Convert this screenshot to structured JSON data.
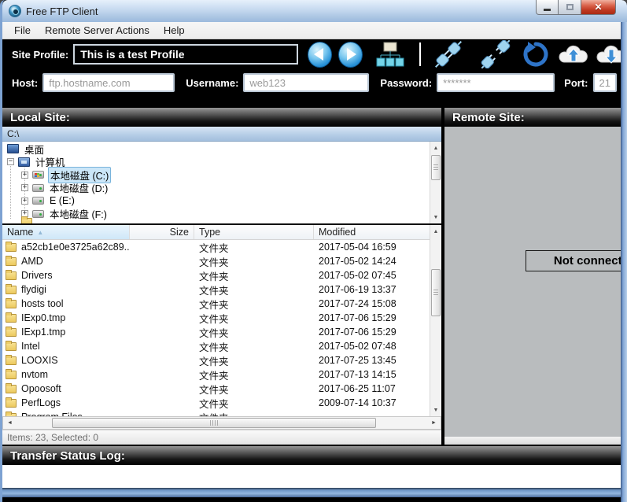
{
  "window": {
    "title": "Free FTP Client"
  },
  "menu": {
    "items": [
      {
        "label": "File"
      },
      {
        "label": "Remote Server Actions"
      },
      {
        "label": "Help"
      }
    ]
  },
  "profile_bar": {
    "label": "Site Profile:",
    "value": "This is a test Profile"
  },
  "connection_bar": {
    "host_label": "Host:",
    "host_value": "ftp.hostname.com",
    "username_label": "Username:",
    "username_value": "web123",
    "password_label": "Password:",
    "password_value": "*******",
    "port_label": "Port:",
    "port_value": "21"
  },
  "local_panel": {
    "header": "Local Site:",
    "path": "C:\\",
    "tree": [
      {
        "label": "桌面",
        "icon": "desktop",
        "expander": null,
        "level": 0,
        "selected": false
      },
      {
        "label": "计算机",
        "icon": "computer",
        "expander": "minus",
        "level": 1,
        "selected": false
      },
      {
        "label": "本地磁盘 (C:)",
        "icon": "drive-win",
        "expander": "plus",
        "level": 2,
        "selected": true
      },
      {
        "label": "本地磁盘 (D:)",
        "icon": "drive",
        "expander": "plus",
        "level": 2,
        "selected": false
      },
      {
        "label": "E (E:)",
        "icon": "drive",
        "expander": "plus",
        "level": 2,
        "selected": false
      },
      {
        "label": "本地磁盘 (F:)",
        "icon": "drive",
        "expander": "plus",
        "level": 2,
        "selected": false
      }
    ],
    "list": {
      "columns": [
        "Name",
        "Size",
        "Type",
        "Modified"
      ],
      "rows": [
        {
          "name": "a52cb1e0e3725a62c89...",
          "size": "",
          "type": "文件夹",
          "modified": "2017-05-04 16:59"
        },
        {
          "name": "AMD",
          "size": "",
          "type": "文件夹",
          "modified": "2017-05-02 14:24"
        },
        {
          "name": "Drivers",
          "size": "",
          "type": "文件夹",
          "modified": "2017-05-02 07:45"
        },
        {
          "name": "flydigi",
          "size": "",
          "type": "文件夹",
          "modified": "2017-06-19 13:37"
        },
        {
          "name": "hosts tool",
          "size": "",
          "type": "文件夹",
          "modified": "2017-07-24 15:08"
        },
        {
          "name": "IExp0.tmp",
          "size": "",
          "type": "文件夹",
          "modified": "2017-07-06 15:29"
        },
        {
          "name": "IExp1.tmp",
          "size": "",
          "type": "文件夹",
          "modified": "2017-07-06 15:29"
        },
        {
          "name": "Intel",
          "size": "",
          "type": "文件夹",
          "modified": "2017-05-02 07:48"
        },
        {
          "name": "LOOXIS",
          "size": "",
          "type": "文件夹",
          "modified": "2017-07-25 13:45"
        },
        {
          "name": "nvtom",
          "size": "",
          "type": "文件夹",
          "modified": "2017-07-13 14:15"
        },
        {
          "name": "Opoosoft",
          "size": "",
          "type": "文件夹",
          "modified": "2017-06-25 11:07"
        },
        {
          "name": "PerfLogs",
          "size": "",
          "type": "文件夹",
          "modified": "2009-07-14 10:37"
        },
        {
          "name": "Program Files",
          "size": "",
          "type": "文件夹",
          "modified": ""
        }
      ]
    },
    "status": "Items: 23, Selected: 0"
  },
  "remote_panel": {
    "header": "Remote Site:",
    "message": "Not connected"
  },
  "transfer_log": {
    "header": "Transfer Status Log:"
  }
}
